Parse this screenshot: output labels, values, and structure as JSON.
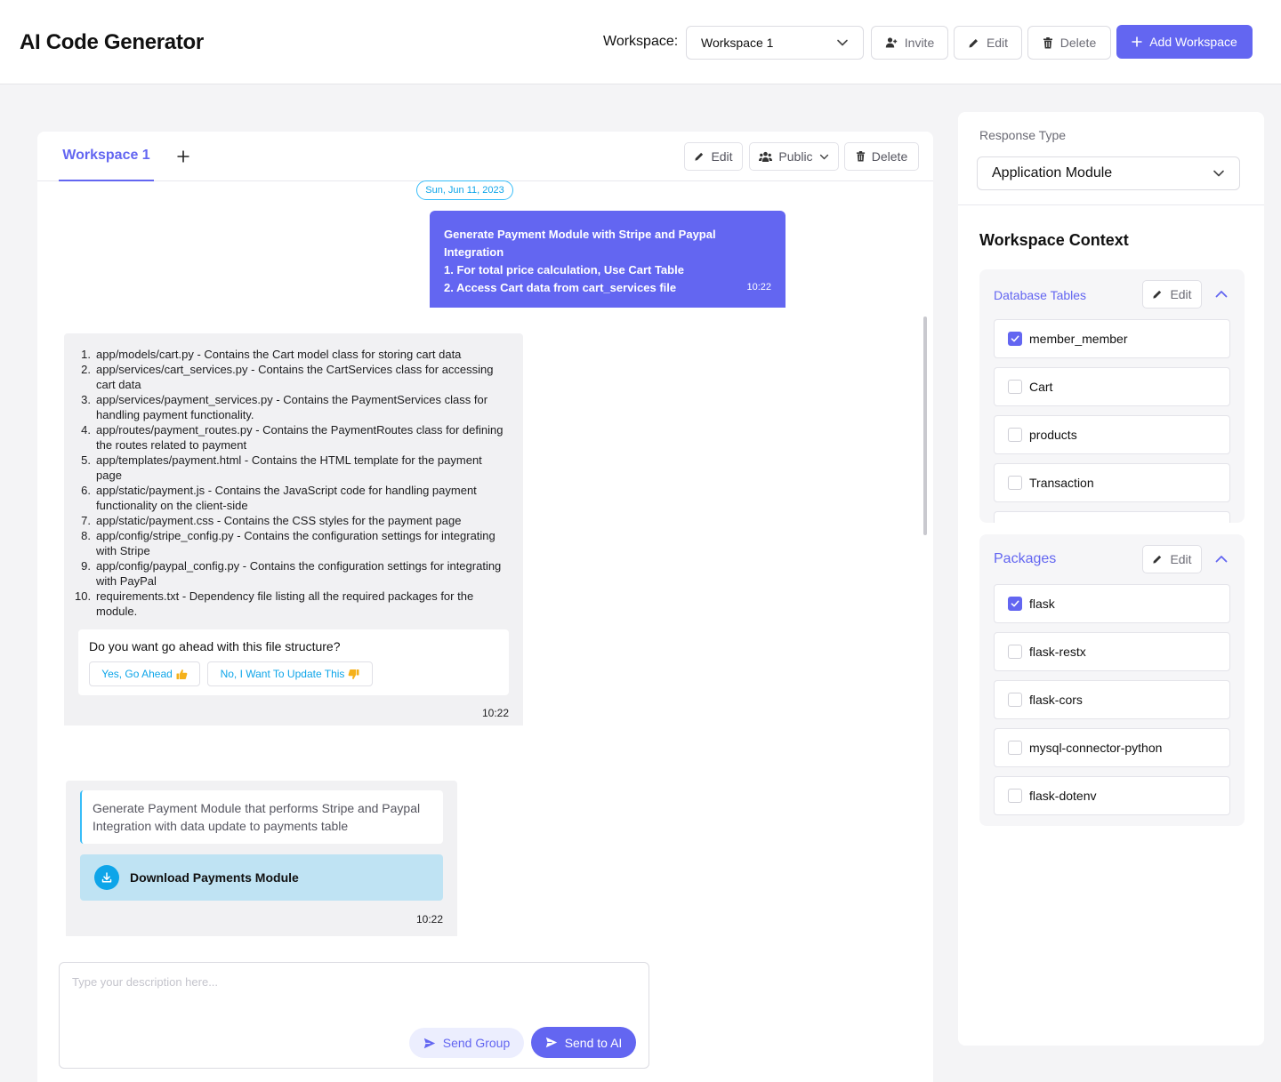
{
  "header": {
    "title": "AI Code Generator",
    "workspace_label": "Workspace:",
    "workspace_selected": "Workspace 1",
    "invite_label": "Invite",
    "edit_label": "Edit",
    "delete_label": "Delete",
    "add_workspace_label": "Add Workspace"
  },
  "main": {
    "tabs": [
      {
        "label": "Workspace 1",
        "active": true
      }
    ],
    "toolbar": {
      "edit_label": "Edit",
      "visibility_label": "Public",
      "delete_label": "Delete"
    },
    "date_divider": "Sun, Jun 11, 2023",
    "user_message": {
      "lines": [
        "Generate Payment Module with Stripe and Paypal",
        "Integration",
        "1. For total price calculation, Use Cart Table",
        "2. Access Cart data from cart_services file"
      ],
      "time": "10:22"
    },
    "ai_message": {
      "items": [
        {
          "num": "1.",
          "text": "app/models/cart.py - Contains the Cart model class for storing cart data"
        },
        {
          "num": "2.",
          "text": "app/services/cart_services.py - Contains the CartServices class for accessing cart data"
        },
        {
          "num": "3.",
          "text": "app/services/payment_services.py - Contains the PaymentServices class for handling payment functionality."
        },
        {
          "num": "4.",
          "text": "app/routes/payment_routes.py - Contains the PaymentRoutes class for defining the routes related to payment"
        },
        {
          "num": "5.",
          "text": "app/templates/payment.html - Contains the HTML template for the payment page"
        },
        {
          "num": "6.",
          "text": "app/static/payment.js - Contains the JavaScript code for handling payment functionality on the client-side"
        },
        {
          "num": "7.",
          "text": "app/static/payment.css - Contains the CSS styles for the payment page"
        },
        {
          "num": "8.",
          "text": "app/config/stripe_config.py - Contains the configuration settings for integrating with Stripe"
        },
        {
          "num": "9.",
          "text": "app/config/paypal_config.py - Contains the configuration settings for integrating with PayPal"
        },
        {
          "num": "10.",
          "text": "requirements.txt - Dependency file listing all the required packages for the module."
        }
      ],
      "question": "Do you want go ahead with this file structure?",
      "yes_label": "Yes, Go Ahead",
      "no_label": "No, I Want To Update This",
      "time": "10:22"
    },
    "download_message": {
      "quote": "Generate Payment Module that performs Stripe and Paypal Integration with data update to payments table",
      "download_label": "Download Payments Module",
      "time": "10:22"
    },
    "composer": {
      "placeholder": "Type your description here...",
      "send_group_label": "Send Group",
      "send_ai_label": "Send to AI"
    }
  },
  "sidebar": {
    "response_type_label": "Response Type",
    "response_type_value": "Application Module",
    "context_title": "Workspace Context",
    "database_tables": {
      "title": "Database Tables",
      "edit_label": "Edit",
      "items": [
        {
          "label": "member_member",
          "checked": true
        },
        {
          "label": "Cart",
          "checked": false
        },
        {
          "label": "products",
          "checked": false
        },
        {
          "label": "Transaction",
          "checked": false
        }
      ]
    },
    "packages": {
      "title": "Packages",
      "edit_label": "Edit",
      "items": [
        {
          "label": "flask",
          "checked": true
        },
        {
          "label": "flask-restx",
          "checked": false
        },
        {
          "label": "flask-cors",
          "checked": false
        },
        {
          "label": "mysql-connector-python",
          "checked": false
        },
        {
          "label": "flask-dotenv",
          "checked": false
        }
      ]
    }
  },
  "colors": {
    "accent": "#6366f1",
    "info": "#0ea5e9",
    "download_bg": "#bfe3f3"
  }
}
